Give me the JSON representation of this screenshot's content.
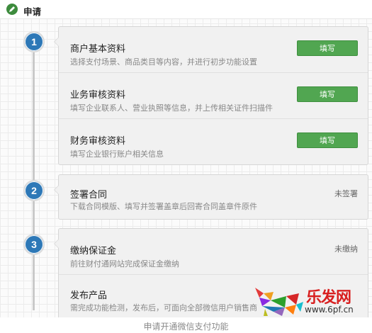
{
  "header": {
    "title": "申请",
    "icon": "pencil-icon"
  },
  "steps": [
    {
      "number": "1",
      "items": [
        {
          "title": "商户基本资料",
          "desc": "选择支付场景、商品类目等内容，并进行初步功能设置",
          "button": "填写"
        },
        {
          "title": "业务审核资料",
          "desc": "填写企业联系人、营业执照等信息，并上传相关证件扫描件",
          "button": "填写"
        },
        {
          "title": "财务审核资料",
          "desc": "填写企业银行账户相关信息",
          "button": "填写"
        }
      ]
    },
    {
      "number": "2",
      "items": [
        {
          "title": "签署合同",
          "desc": "下载合同模版、填写并签署盖章后回寄合同盖章件原件",
          "status": "未签署"
        }
      ]
    },
    {
      "number": "3",
      "items": [
        {
          "title": "缴纳保证金",
          "desc": "前往财付通网站完成保证金缴纳",
          "status": "未缴纳"
        },
        {
          "title": "发布产品",
          "desc": "需完成功能检测，发布后，可面向全部微信用户销售商"
        }
      ]
    }
  ],
  "watermark": {
    "text": "乐发网",
    "url": "www.6pf.cn"
  },
  "caption": "申请开通微信支付功能",
  "colors": {
    "accent": "#2d78b7",
    "button": "#51a651",
    "brand_red": "#d81f1f"
  }
}
